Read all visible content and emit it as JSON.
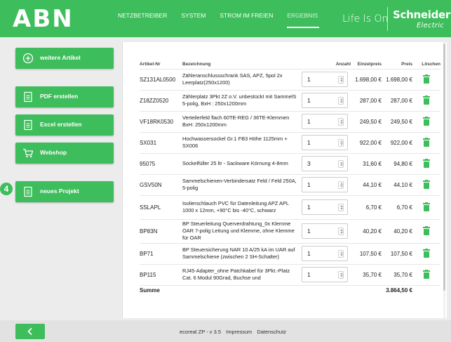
{
  "header": {
    "logo": "ABN",
    "nav": [
      "NETZBETREIBER",
      "SYSTEM",
      "STROM IM FREIEN",
      "ERGEBNIS"
    ],
    "active_tab": "ERGEBNIS",
    "tagline": "Life Is On",
    "brand": "Schneider",
    "brand_sub": "Electric",
    "accent_color": "#3dbd5b"
  },
  "sidebar": {
    "buttons": [
      {
        "label": "weitere Artikel",
        "icon": "plus-circle-icon"
      },
      {
        "label": "PDF erstellen",
        "icon": "document-icon"
      },
      {
        "label": "Excel erstellen",
        "icon": "document-icon"
      },
      {
        "label": "Webshop",
        "icon": "cart-icon"
      },
      {
        "label": "neues Projekt",
        "icon": "document-icon"
      }
    ],
    "step_badge": "4"
  },
  "table": {
    "headers": {
      "artikel": "Artikel-Nr",
      "bezeichnung": "Bezeichnung",
      "anzahl": "Anzahl",
      "einzelpreis": "Einzelpreis",
      "preis": "Preis",
      "loeschen": "Löschen"
    },
    "rows": [
      {
        "artikel": "SZ131AL0500",
        "bezeichnung": "Zähleranschlussschrank SAS, APZ, 5pol 2x Leerplatz(250x1200)",
        "anzahl": "1",
        "einzelpreis": "1.698,00 €",
        "preis": "1.698,00 €"
      },
      {
        "artikel": "Z18ZZ0520",
        "bezeichnung": "Zählerplatz 3Pkt 2Z o.V. unbestückt mit SammelS 5-polig, BxH : 250x1200mm",
        "anzahl": "1",
        "einzelpreis": "287,00 €",
        "preis": "287,00 €"
      },
      {
        "artikel": "VF18RK0530",
        "bezeichnung": "Verteilerfeld flach 60TE-REG / 36TE-Klemmen BxH: 250x1200mm",
        "anzahl": "1",
        "einzelpreis": "249,50 €",
        "preis": "249,50 €"
      },
      {
        "artikel": "SX031",
        "bezeichnung": "Hochwassersockel Gr.1 FB3 Höhe 1125mm + SX006",
        "anzahl": "1",
        "einzelpreis": "922,00 €",
        "preis": "922,00 €"
      },
      {
        "artikel": "95075",
        "bezeichnung": "Sockelfüller 25 ltr - Sackware Körnung 4-8mm",
        "anzahl": "3",
        "einzelpreis": "31,60 €",
        "preis": "94,80 €"
      },
      {
        "artikel": "GSV50N",
        "bezeichnung": "Sammelschienen-Verbindersatz Feld / Feld 250A, 5-polig",
        "anzahl": "1",
        "einzelpreis": "44,10 €",
        "preis": "44,10 €"
      },
      {
        "artikel": "SSLAPL",
        "bezeichnung": "Isolierschlauch PVC für Datenleitung APZ APL 1000 x 12mm, +90°C bis -40°C, schwarz",
        "anzahl": "1",
        "einzelpreis": "6,70 €",
        "preis": "6,70 €"
      },
      {
        "artikel": "BP83N",
        "bezeichnung": "BP Steuerleitung Querverdrahtung_0x Klemme OAR 7-polig Leitung und Klemme, ohne Klemme für OAR",
        "anzahl": "1",
        "einzelpreis": "40,20 €",
        "preis": "40,20 €"
      },
      {
        "artikel": "BP71",
        "bezeichnung": "BP Steuersicherung NAR 10 A/25 kA im UAR auf Sammelschiene (zwischen 2 SH-Schalter)",
        "anzahl": "1",
        "einzelpreis": "107,50 €",
        "preis": "107,50 €"
      },
      {
        "artikel": "BP115",
        "bezeichnung": "RJ45-Adapter_ohne Patchkabel für 3Pkt.-Platz Cat. 6 Modul 90Grad, Buchse und",
        "anzahl": "1",
        "einzelpreis": "35,70 €",
        "preis": "35,70 €"
      }
    ],
    "sum_label": "Summe",
    "sum_value": "3.864,50 €"
  },
  "footer": {
    "version": "ecoreal ZP - v 3.5",
    "impressum": "Impressum",
    "datenschutz": "Datenschutz"
  }
}
